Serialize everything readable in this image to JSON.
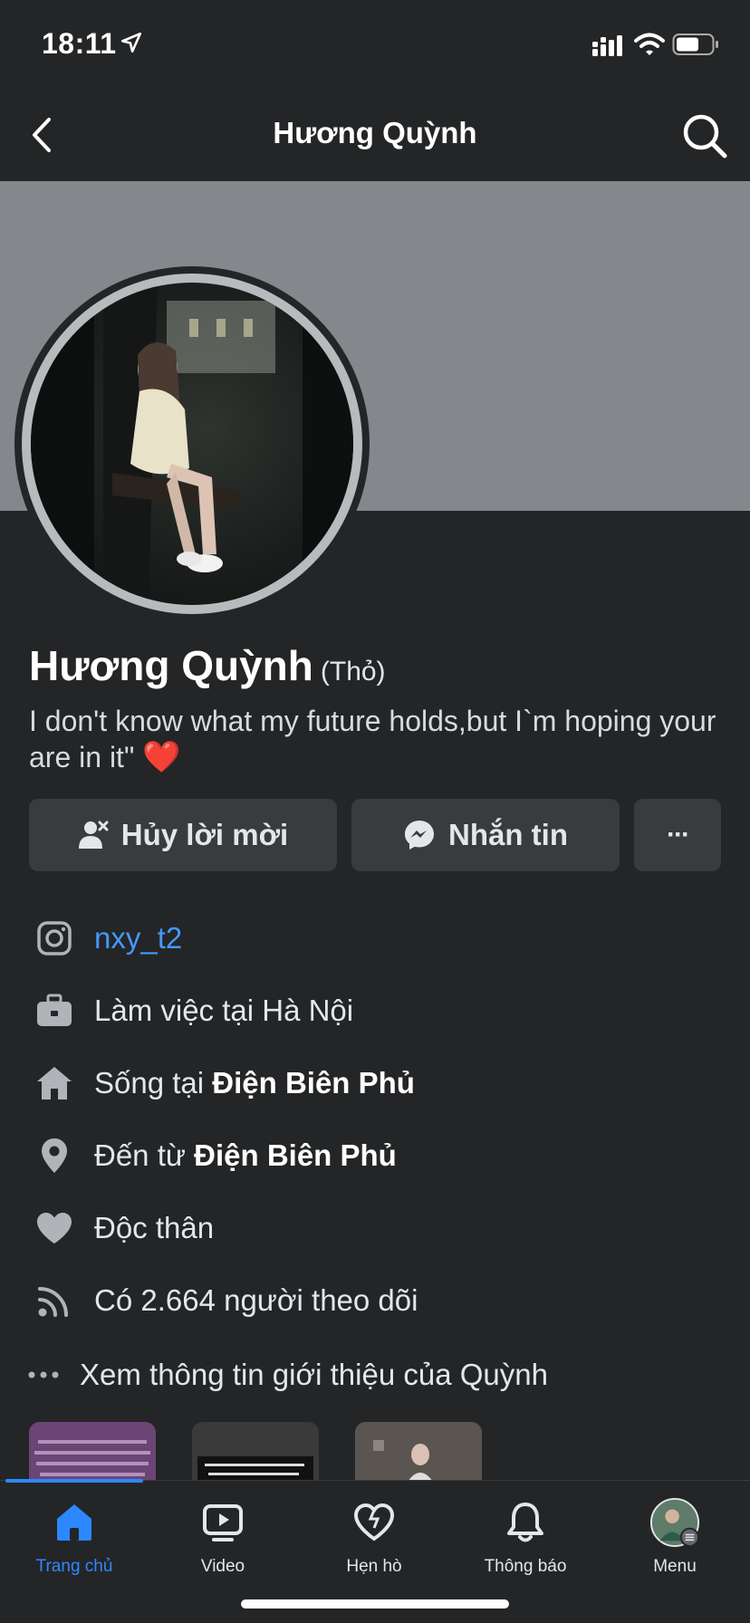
{
  "status_bar": {
    "time": "18:11"
  },
  "header": {
    "title": "Hương Quỳnh"
  },
  "profile": {
    "name": "Hương Quỳnh",
    "nickname": "(Thỏ)",
    "bio": "I don't know what my future holds,but I`m hoping your are in it\"",
    "bio_emoji": "❤️"
  },
  "actions": {
    "cancel_request": "Hủy lời mời",
    "message": "Nhắn tin",
    "more": "···"
  },
  "info": {
    "instagram": "nxy_t2",
    "work": "Làm việc tại Hà Nội",
    "lives_prefix": "Sống tại ",
    "lives_place": "Điện Biên Phủ",
    "from_prefix": "Đến từ ",
    "from_place": "Điện Biên Phủ",
    "relationship": "Độc thân",
    "followers": "Có 2.664 người theo dõi",
    "see_about": "Xem thông tin giới thiệu của Quỳnh"
  },
  "nav": {
    "items": [
      {
        "label": "Trang chủ",
        "active": true
      },
      {
        "label": "Video"
      },
      {
        "label": "Hẹn hò"
      },
      {
        "label": "Thông báo"
      },
      {
        "label": "Menu"
      }
    ]
  },
  "colors": {
    "accent": "#2d88ff",
    "link": "#4599ff",
    "background": "#242526",
    "cover": "#84878b"
  }
}
